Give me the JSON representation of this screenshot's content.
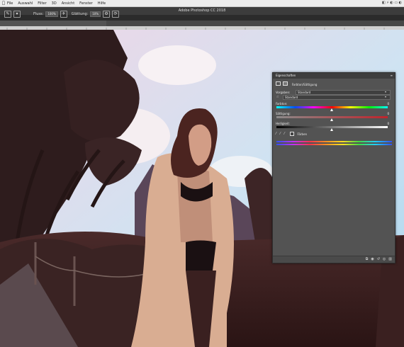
{
  "menubar": {
    "apple": "",
    "items": [
      "File",
      "Auswahl",
      "Filter",
      "3D",
      "Ansicht",
      "Fenster",
      "Hilfe"
    ],
    "status_icons": "◧ ⚡ ◐ ▭ ◐"
  },
  "window": {
    "title": "Adobe Photoshop CC 2018"
  },
  "options": {
    "tool_icon": "brush-icon",
    "flow_label": "Fluss:",
    "flow_value": "100%",
    "smoothing_label": "Glättung:",
    "smoothing_value": "10%"
  },
  "panel": {
    "title": "Eigenschaften",
    "close": "≡",
    "layer_title": "Farbton/Sättigung",
    "preset_label": "Vorgaben:",
    "preset_value": "Standard",
    "channel_value": "Standard",
    "hue_label": "Farbton:",
    "hue_value": "0",
    "saturation_label": "Sättigung:",
    "saturation_value": "0",
    "lightness_label": "Helligkeit:",
    "lightness_value": "0",
    "colorize_label": "Färben",
    "accent": "#3a8ee6"
  }
}
